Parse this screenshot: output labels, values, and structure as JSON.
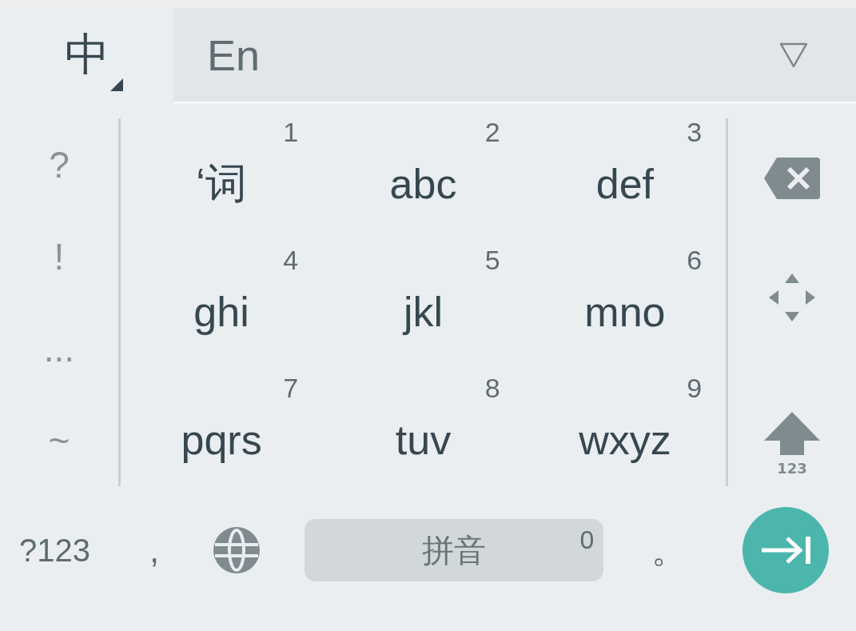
{
  "tabs": [
    {
      "label": "中",
      "selected": true
    },
    {
      "label": "En",
      "selected": false
    }
  ],
  "symbols": [
    "?",
    "!",
    "...",
    "~"
  ],
  "keys": [
    {
      "label": "‘词",
      "number": "1"
    },
    {
      "label": "abc",
      "number": "2"
    },
    {
      "label": "def",
      "number": "3"
    },
    {
      "label": "ghi",
      "number": "4"
    },
    {
      "label": "jkl",
      "number": "5"
    },
    {
      "label": "mno",
      "number": "6"
    },
    {
      "label": "pqrs",
      "number": "7"
    },
    {
      "label": "tuv",
      "number": "8"
    },
    {
      "label": "wxyz",
      "number": "9"
    }
  ],
  "side_keys": [
    {
      "kind": "backspace"
    },
    {
      "kind": "cursor"
    },
    {
      "kind": "shift",
      "label": "123"
    }
  ],
  "bottom_row": {
    "symbols_key": "?123",
    "comma": ",",
    "space": {
      "label": "拼音",
      "count": "0"
    },
    "period": "。"
  }
}
